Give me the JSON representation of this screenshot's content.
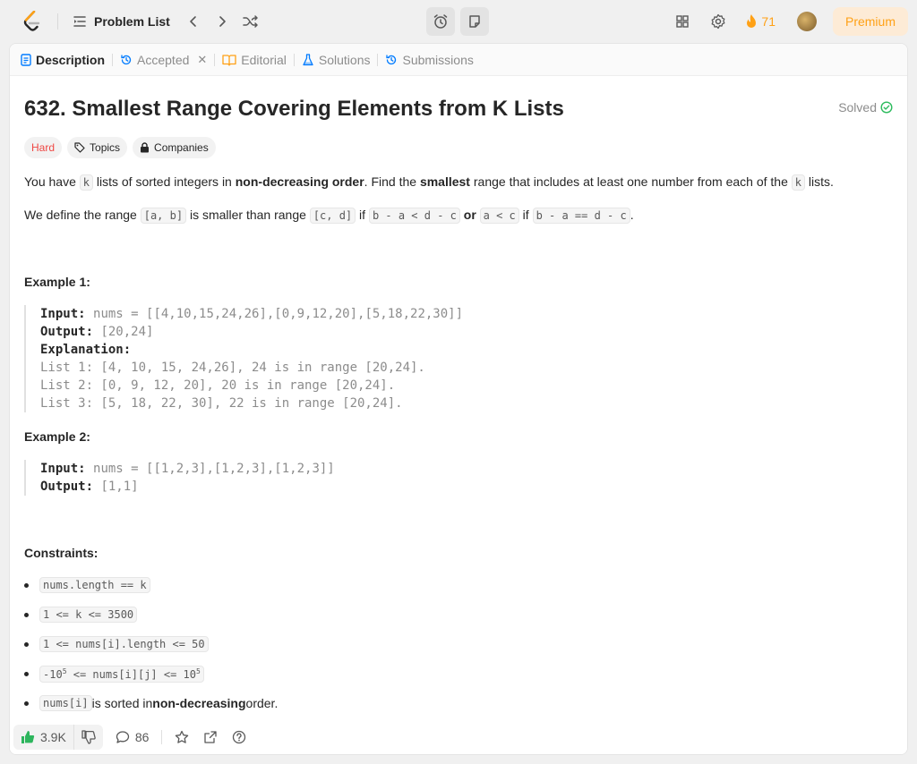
{
  "topbar": {
    "problem_list_label": "Problem List",
    "streak_count": "71",
    "premium_label": "Premium"
  },
  "tabs": [
    {
      "label": "Description"
    },
    {
      "label": "Accepted"
    },
    {
      "label": "Editorial"
    },
    {
      "label": "Solutions"
    },
    {
      "label": "Submissions"
    }
  ],
  "problem": {
    "title": "632. Smallest Range Covering Elements from K Lists",
    "status": "Solved",
    "difficulty": "Hard",
    "topics_label": "Topics",
    "companies_label": "Companies"
  },
  "description": {
    "p1": {
      "t1": "You have ",
      "c1": "k",
      "t2": " lists of sorted integers in ",
      "b1": "non-decreasing order",
      "t3": ". Find the ",
      "b2": "smallest",
      "t4": " range that includes at least one number from each of the ",
      "c2": "k",
      "t5": " lists."
    },
    "p2": {
      "t1": "We define the range ",
      "c1": "[a, b]",
      "t2": " is smaller than range ",
      "c2": "[c, d]",
      "t3": " if ",
      "c3": "b - a < d - c",
      "b1": "or",
      "c4": "a < c",
      "t4": " if ",
      "c5": "b - a == d - c",
      "t5": "."
    }
  },
  "examples": [
    {
      "heading": "Example 1:",
      "input_label": "Input:",
      "input": "nums = [[4,10,15,24,26],[0,9,12,20],[5,18,22,30]]",
      "output_label": "Output:",
      "output": "[20,24]",
      "explanation_label": "Explanation:",
      "explanation": [
        "List 1: [4, 10, 15, 24,26], 24 is in range [20,24].",
        "List 2: [0, 9, 12, 20], 20 is in range [20,24].",
        "List 3: [5, 18, 22, 30], 22 is in range [20,24]."
      ]
    },
    {
      "heading": "Example 2:",
      "input_label": "Input:",
      "input": "nums = [[1,2,3],[1,2,3],[1,2,3]]",
      "output_label": "Output:",
      "output": "[1,1]"
    }
  ],
  "constraints": {
    "heading": "Constraints:",
    "c1": "nums.length == k",
    "c2": "1 <= k <= 3500",
    "c3": "1 <= nums[i].length <= 50",
    "c4a": "-10",
    "c4sup1": "5",
    "c4b": " <= nums[i][j] <= 10",
    "c4sup2": "5",
    "c5code": "nums[i]",
    "c5t1": " is sorted in ",
    "c5b": "non-decreasing",
    "c5t2": " order."
  },
  "actions": {
    "likes": "3.9K",
    "comments": "86"
  },
  "colors": {
    "brand_orange": "#ffa116",
    "hard_red": "#ef4743",
    "solved_green": "#2cbb5d",
    "like_green": "#2db55d"
  }
}
